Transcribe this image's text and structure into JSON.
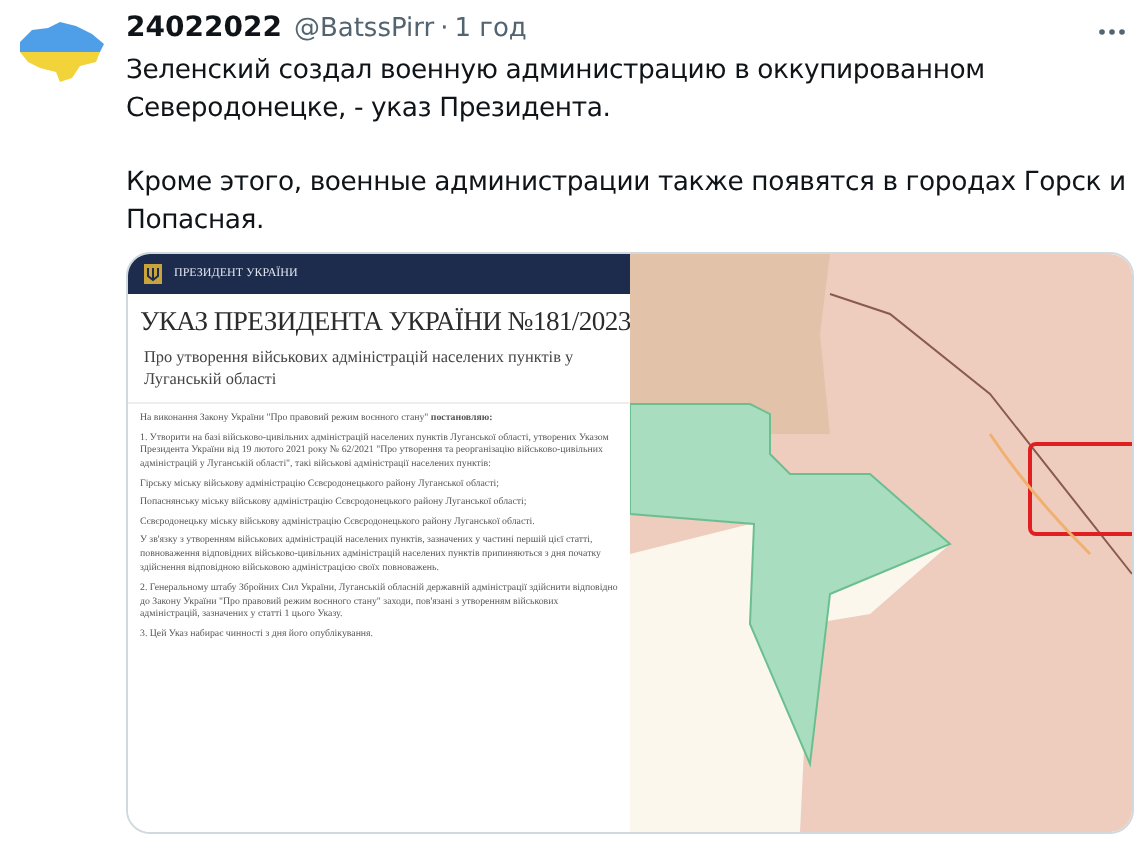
{
  "tweet": {
    "author": "24022022",
    "handle": "@BatssPirr",
    "separator": "·",
    "time": "1 год",
    "paragraphs": [
      "Зеленский создал военную администрацию в оккупированном Северодонецке, - указ Президента.",
      "Кроме этого, военные администрации также появятся в городах Горск и Попасная."
    ]
  },
  "document": {
    "header": "ПРЕЗИДЕНТ УКРАЇНИ",
    "title": "УКАЗ ПРЕЗИДЕНТА УКРАЇНИ №181/2023",
    "subtitle": "Про утворення військових адміністрацій населених пунктів у Луганській області",
    "paragraphs": [
      "На виконання Закону України \"Про правовий режим воєнного стану\" **постановляю:**",
      "1. Утворити на базі військово-цивільних адміністрацій населених пунктів Луганської області, утворених Указом Президента України від 19 лютого 2021 року № 62/2021 \"Про утворення та реорганізацію військово-цивільних адміністрацій у Луганській області\", такі військові адміністрації населених пунктів:",
      "Гірську міську військову адміністрацію Сєвєродонецького району Луганської області;",
      "Попаснянську міську військову адміністрацію Сєвєродонецького району Луганської області;",
      "Сєвєродонецьку міську військову адміністрацію Сєвєродонецького району Луганської області.",
      "У зв'язку з утворенням військових адміністрацій населених пунктів, зазначених у частині першій цієї статті, повноваження відповідних військово-цивільних адміністрацій населених пунктів припиняються з дня початку здійснення відповідною військовою адміністрацією своїх повноважень.",
      "2. Генеральному штабу Збройних Сил України, Луганській обласній державній адміністрації здійснити відповідно до Закону України \"Про правовий режим воєнного стану\" заходи, пов'язані з утворенням військових адміністрацій, зазначених у статті 1 цього Указу.",
      "3. Цей Указ набирає чинності з дня його опублікування."
    ]
  }
}
